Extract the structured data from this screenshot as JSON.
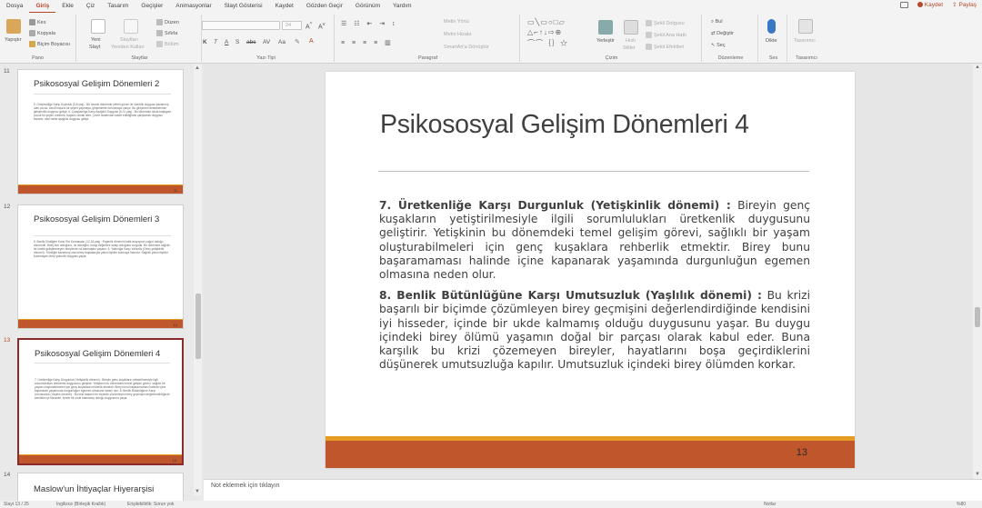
{
  "colors": {
    "accent": "#b7472a",
    "slide_bar": "#c0562b",
    "slide_bar_top": "#e49d22",
    "selected_border": "#8b2a2a"
  },
  "tabs": [
    "Dosya",
    "Giriş",
    "Ekle",
    "Çiz",
    "Tasarım",
    "Geçişler",
    "Animasyonlar",
    "Slayt Gösterisi",
    "Kaydet",
    "Gözden Geçir",
    "Görünüm",
    "Yardım"
  ],
  "active_tab": "Giriş",
  "topright": {
    "comment_icon": "comment-icon",
    "record": "Kaydet",
    "share": "Paylaş"
  },
  "ribbon": {
    "clipboard": {
      "label": "Pano",
      "paste": "Yapıştır",
      "cut": "Kes",
      "copy": "Kopyala",
      "format_painter": "Biçim Boyacısı"
    },
    "slides": {
      "label": "Slaytlar",
      "new_slide": "Yeni",
      "new_slide_2": "Slayt",
      "reuse": "Slaytları",
      "reuse_2": "Yeniden Kullan",
      "layout": "Düzen",
      "reset": "Sıfırla",
      "section": "Bölüm"
    },
    "font": {
      "label": "Yazı Tipi",
      "font_name": "",
      "font_size": "24"
    },
    "paragraph": {
      "label": "Paragraf",
      "text_direction": "Metin Yönü",
      "align_text": "Metni Hizala",
      "smartart": "SmartArt'a Dönüştür"
    },
    "drawing": {
      "label": "Çizim",
      "arrange": "Yerleştir",
      "quick_styles": "Hızlı",
      "quick_styles_2": "Stiller",
      "shape_fill": "Şekil Dolgusu",
      "shape_outline": "Şekil Ana Hattı",
      "shape_effects": "Şekil Efektleri"
    },
    "editing": {
      "label": "Düzenleme",
      "find": "Bul",
      "replace": "Değiştir",
      "select": "Seç"
    },
    "voice": {
      "label": "Ses",
      "dictate": "Dikte"
    },
    "designer": {
      "label": "Tasarımcı",
      "designer": "Tasarımcı"
    }
  },
  "thumbnails": [
    {
      "number": "11",
      "title": "Psikososyal Gelişim Dönemleri 2",
      "body": "5. Girişimciliğe Karşı Suçluluk (3-6 yaş) : Bir önceki dönemde yeterli güven ile özerklik duygusu kazanmış olan çocuk, kendi başına bir şeyler yapmaya, girişimlerde bulunmaya çalışır. Bu girişimleri desteklenirse girişimcilik duygusu gelişir. 6. Çalışkanlığa Karşı Aşağılık Duygusu (6-11 yaş) : Bu dönemde okula başlayan çocuk bir şeyler üretmek, başarılı olmak ister. Çevre tarafından takdir edildiğinde çalışkanlık duygusu kazanır, aksi halde aşağılık duygusu gelişir.",
      "page": "11"
    },
    {
      "number": "12",
      "title": "Psikososyal Gelişim Dönemleri 3",
      "body": "5. Benlik Kimliğine Karşı Rol Karmaşası (12-18 yaş) : Ergenlik dönemi kimlik arayışının yoğun olduğu dönemdir. Birey kim olduğunu, ne istediğini, hangi değerlere sahip olduğunu sorgular. Bu dönemde sağlıklı bir kimlik geliştiremeyen bireylerde rol karmaşası yaşanır. 6. Yakınlığa Karşı Yalnızlık (Genç yetişkinlik dönemi) : Kimliğini kazanmış olan birey başkalarıyla yakın ilişkiler kurmaya hazırdır. Sağlıklı yakın ilişkiler kuramayan birey yalnızlık duygusu yaşar.",
      "page": "12"
    },
    {
      "number": "13",
      "title": "Psikososyal Gelişim Dönemleri 4",
      "body": "7. Üretkenliğe Karşı Durgunluk (Yetişkinlik dönemi) : Bireyin genç kuşakların yetiştirilmesiyle ilgili sorumlulukları üretkenlik duygusunu geliştirir. Yetişkinin bu dönemdeki temel gelişim görevi, sağlıklı bir yaşam oluşturabilmeleri için genç kuşaklara rehberlik etmektir. Birey bunu başaramaması halinde içine kapanarak yaşamında durgunluğun egemen olmasına neden olur. 8. Benlik Bütünlüğüne Karşı Umutsuzluk (Yaşlılık dönemi) : Bu krizi başarılı bir biçimde çözümleyen birey geçmişini değerlendirdiğinde kendisini iyi hisseder, içinde bir ukde kalmamış olduğu duygusunu yaşar.",
      "page": "13"
    },
    {
      "number": "14",
      "title": "Maslow'un İhtiyaçlar Hiyerarşisi",
      "body": "",
      "page": ""
    }
  ],
  "slide": {
    "title": "Psikososyal Gelişim Dönemleri 4",
    "p1_bold": "7. Üretkenliğe Karşı Durgunluk (Yetişkinlik dönemi) :",
    "p1_text": " Bireyin genç kuşakların yetiştirilmesiyle ilgili sorumlulukları üretkenlik duygusunu geliştirir. Yetişkinin bu dönemdeki temel gelişim görevi, sağlıklı bir yaşam oluşturabilmeleri için genç kuşaklara rehberlik etmektir. Birey bunu başaramaması halinde içine kapanarak yaşamında durgunluğun egemen olmasına neden olur.",
    "p2_bold": "8. Benlik Bütünlüğüne Karşı Umutsuzluk (Yaşlılık dönemi) :",
    "p2_text": " Bu krizi başarılı bir biçimde çözümleyen birey geçmişini değerlendirdiğinde kendisini iyi hisseder, içinde bir ukde kalmamış olduğu duygusunu yaşar. Bu duygu içindeki birey ölümü yaşamın doğal bir parçası olarak kabul eder. Buna karşılık bu krizi çözemeyen bireyler, hayatlarını boşa geçirdiklerini düşünerek umutsuzluğa kapılır. Umutsuzluk içindeki birey ölümden korkar.",
    "page_number": "13"
  },
  "notes_placeholder": "Not eklemek için tıklayın",
  "status": {
    "slide_info": "Slayt 13 / 25",
    "language": "İngilizce (Birleşik Krallık)",
    "accessibility": "Erişilebilirlik: Sorun yok",
    "notes": "Notlar",
    "zoom": "%80"
  }
}
